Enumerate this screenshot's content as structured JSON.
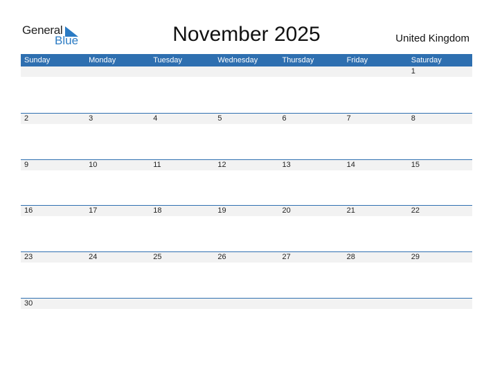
{
  "brand": {
    "word1": "General",
    "word2": "Blue"
  },
  "title": "November 2025",
  "country": "United Kingdom",
  "colors": {
    "accent": "#2e6fb0",
    "cell_bg": "#f2f2f2"
  },
  "weekdays": [
    "Sunday",
    "Monday",
    "Tuesday",
    "Wednesday",
    "Thursday",
    "Friday",
    "Saturday"
  ],
  "weeks": [
    [
      "",
      "",
      "",
      "",
      "",
      "",
      "1"
    ],
    [
      "2",
      "3",
      "4",
      "5",
      "6",
      "7",
      "8"
    ],
    [
      "9",
      "10",
      "11",
      "12",
      "13",
      "14",
      "15"
    ],
    [
      "16",
      "17",
      "18",
      "19",
      "20",
      "21",
      "22"
    ],
    [
      "23",
      "24",
      "25",
      "26",
      "27",
      "28",
      "29"
    ],
    [
      "30",
      "",
      "",
      "",
      "",
      "",
      ""
    ]
  ]
}
